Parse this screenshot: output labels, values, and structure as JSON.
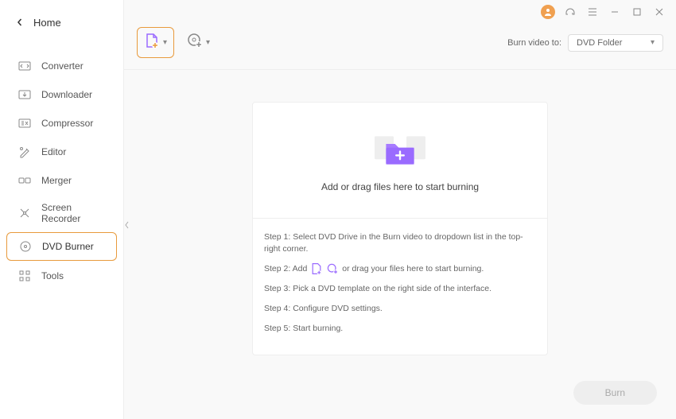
{
  "header": {
    "home": "Home"
  },
  "sidebar": {
    "items": [
      {
        "label": "Converter"
      },
      {
        "label": "Downloader"
      },
      {
        "label": "Compressor"
      },
      {
        "label": "Editor"
      },
      {
        "label": "Merger"
      },
      {
        "label": "Screen Recorder"
      },
      {
        "label": "DVD Burner"
      },
      {
        "label": "Tools"
      }
    ]
  },
  "toolbar": {
    "burn_to_label": "Burn video to:",
    "burn_to_value": "DVD Folder"
  },
  "dropzone": {
    "prompt": "Add or drag files here to start burning",
    "steps": {
      "s1": "Step 1: Select DVD Drive in the Burn video to dropdown list in the top-right corner.",
      "s2a": "Step 2: Add",
      "s2b": "or drag your files here to start burning.",
      "s3": "Step 3: Pick a DVD template on the right side of the interface.",
      "s4": "Step 4: Configure DVD settings.",
      "s5": "Step 5: Start burning."
    }
  },
  "footer": {
    "burn": "Burn"
  }
}
